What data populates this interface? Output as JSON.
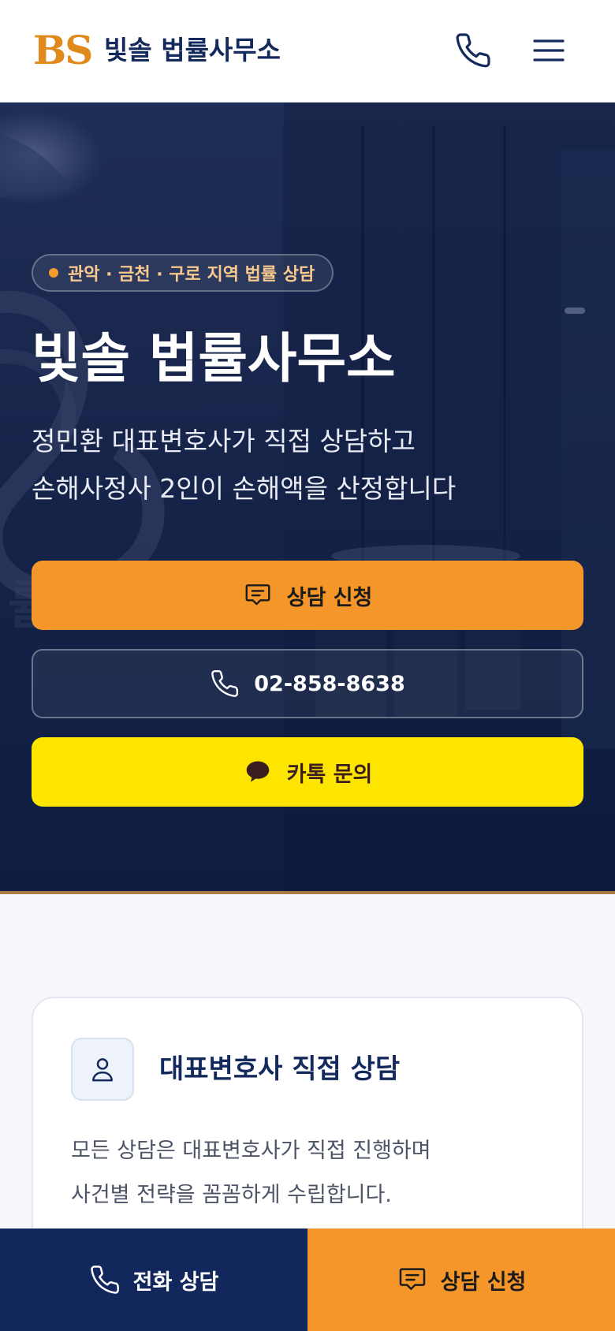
{
  "header": {
    "logo_mark": "BS",
    "logo_text": "빛솔 법률사무소",
    "phone_icon": "phone-icon",
    "menu_icon": "hamburger-menu-icon"
  },
  "hero": {
    "badge": "관악 · 금천 · 구로 지역 법률 상담",
    "title": "빛솔 법률사무소",
    "subtitle_line1": "정민환 대표변호사가 직접 상담하고",
    "subtitle_line2": "손해사정사 2인이 손해액을 산정합니다",
    "btn_consult": "상담 신청",
    "btn_phone": "02-858-8638",
    "btn_kakao": "카톡 문의"
  },
  "feature": {
    "title": "대표변호사 직접 상담",
    "desc_line1": "모든 상담은 대표변호사가 직접 진행하며",
    "desc_line2": "사건별 전략을 꼼꼼하게 수립합니다."
  },
  "bottom_bar": {
    "call": "전화 상담",
    "consult": "상담 신청"
  },
  "colors": {
    "brand_orange": "#f5962b",
    "navy": "#12275c",
    "kakao_yellow": "#fee500"
  }
}
